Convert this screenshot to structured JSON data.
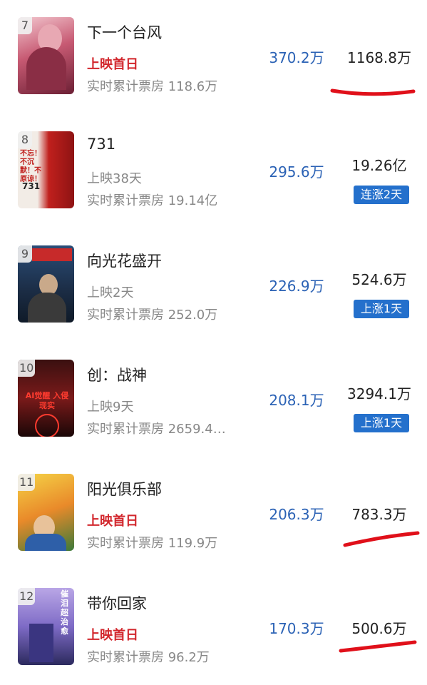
{
  "movies": [
    {
      "rank": "7",
      "title": "下一个台风",
      "status": "上映首日",
      "status_style": "red",
      "total": "实时累计票房 118.6万",
      "daily": "370.2万",
      "cumulative": "1168.8万",
      "badge": null,
      "underline": true
    },
    {
      "rank": "8",
      "title": "731",
      "status": "上映38天",
      "status_style": "gray",
      "total": "实时累计票房 19.14亿",
      "daily": "295.6万",
      "cumulative": "19.26亿",
      "badge": "连涨2天",
      "underline": false,
      "poster_text": "不忘！不沉默！不原谅！",
      "poster_code": "731"
    },
    {
      "rank": "9",
      "title": "向光花盛开",
      "status": "上映2天",
      "status_style": "gray",
      "total": "实时累计票房 252.0万",
      "daily": "226.9万",
      "cumulative": "524.6万",
      "badge": "上涨1天",
      "underline": false
    },
    {
      "rank": "10",
      "title": "创：战神",
      "status": "上映9天",
      "status_style": "gray",
      "total": "实时累计票房 2659.4…",
      "daily": "208.1万",
      "cumulative": "3294.1万",
      "badge": "上涨1天",
      "underline": false,
      "poster_text": "AI觉醒 入侵现实"
    },
    {
      "rank": "11",
      "title": "阳光俱乐部",
      "status": "上映首日",
      "status_style": "red",
      "total": "实时累计票房 119.9万",
      "daily": "206.3万",
      "cumulative": "783.3万",
      "badge": null,
      "underline": true
    },
    {
      "rank": "12",
      "title": "带你回家",
      "status": "上映首日",
      "status_style": "red",
      "total": "实时累计票房 96.2万",
      "daily": "170.3万",
      "cumulative": "500.6万",
      "badge": null,
      "underline": true,
      "poster_text": "催泪超治愈"
    }
  ],
  "colors": {
    "accent_blue": "#2b62b5",
    "badge_blue": "#2470cc",
    "status_red": "#d2262c",
    "annotation_red": "#e0101a"
  }
}
